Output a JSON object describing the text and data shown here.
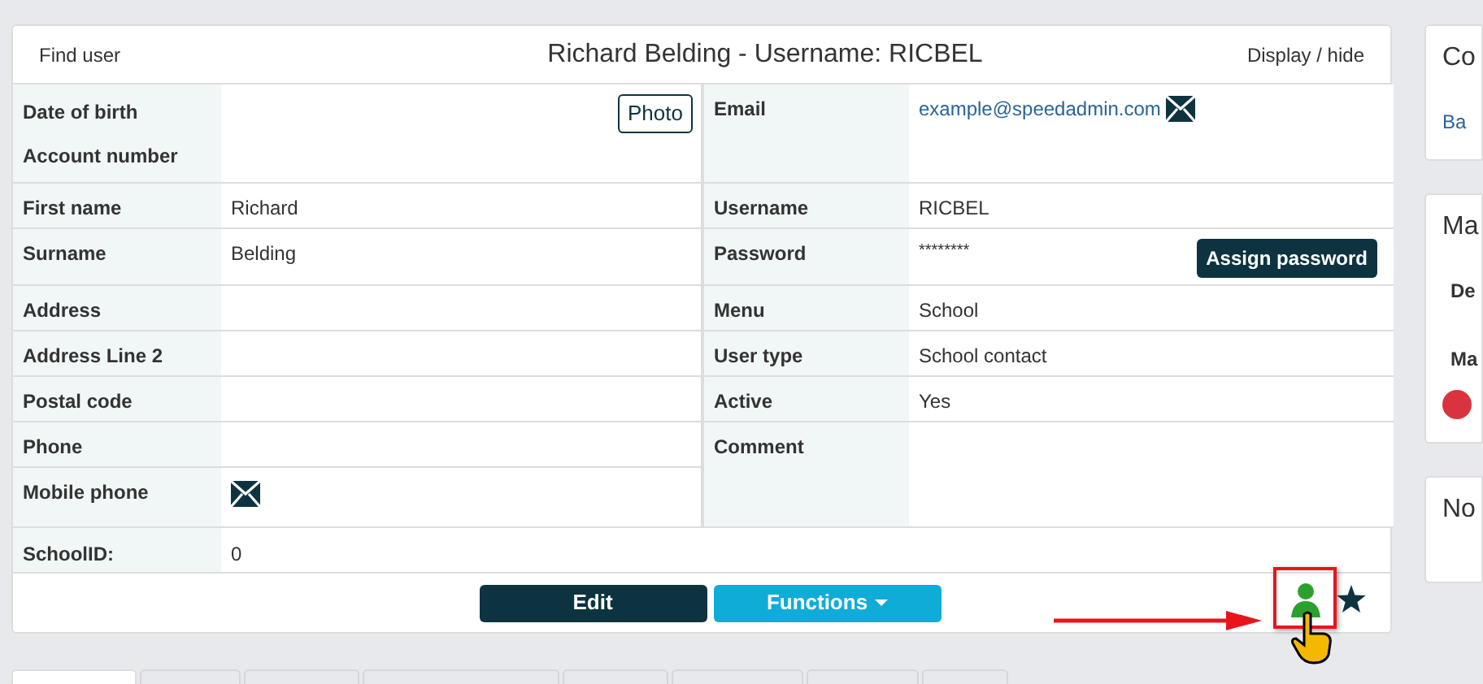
{
  "header": {
    "left_link": "Find user",
    "title": "Richard Belding - Username: RICBEL",
    "right_link": "Display / hide"
  },
  "left_fields": [
    {
      "kind": "photo",
      "labels": [
        "Date of birth",
        "Account number"
      ],
      "button": "Photo"
    },
    {
      "kind": "text",
      "label": "First name",
      "value": "Richard"
    },
    {
      "kind": "text",
      "label": "Surname",
      "value": "Belding"
    },
    {
      "kind": "text",
      "label": "Address"
    },
    {
      "kind": "text",
      "label": "Address Line 2"
    },
    {
      "kind": "text",
      "label": "Postal code"
    },
    {
      "kind": "text",
      "label": "Phone"
    },
    {
      "kind": "mail",
      "label": "Mobile phone"
    }
  ],
  "right_fields": [
    {
      "kind": "email",
      "label": "Email",
      "value": "example@speedadmin.com"
    },
    {
      "kind": "text",
      "label": "Username",
      "value": "RICBEL"
    },
    {
      "kind": "password",
      "label": "Password",
      "value": "********",
      "button": "Assign password"
    },
    {
      "kind": "text",
      "label": "Menu",
      "value": "School"
    },
    {
      "kind": "text",
      "label": "User type",
      "value": "School contact"
    },
    {
      "kind": "text",
      "label": "Active",
      "value": "Yes"
    },
    {
      "kind": "comment",
      "label": "Comment"
    }
  ],
  "school_id": {
    "label": "SchoolID:",
    "value": "0"
  },
  "footer": {
    "buttons": [
      {
        "kind": "primary",
        "label": "Edit"
      },
      {
        "kind": "dropdown",
        "label": "Functions"
      }
    ]
  },
  "side_cards": [
    {
      "title": "Co",
      "lines": [
        {
          "kind": "link",
          "text": "Ba"
        }
      ]
    },
    {
      "title": "Ma",
      "lines": [
        {
          "kind": "bold",
          "text": "De"
        },
        {
          "kind": "bold",
          "text": "Ma"
        },
        {
          "kind": "badge"
        }
      ]
    },
    {
      "title": "No"
    }
  ],
  "tabs": [
    {
      "selected": true
    },
    {
      "selected": false
    },
    {
      "selected": false
    },
    {
      "selected": false
    },
    {
      "selected": false
    },
    {
      "selected": false
    },
    {
      "selected": false
    },
    {
      "selected": false
    }
  ]
}
